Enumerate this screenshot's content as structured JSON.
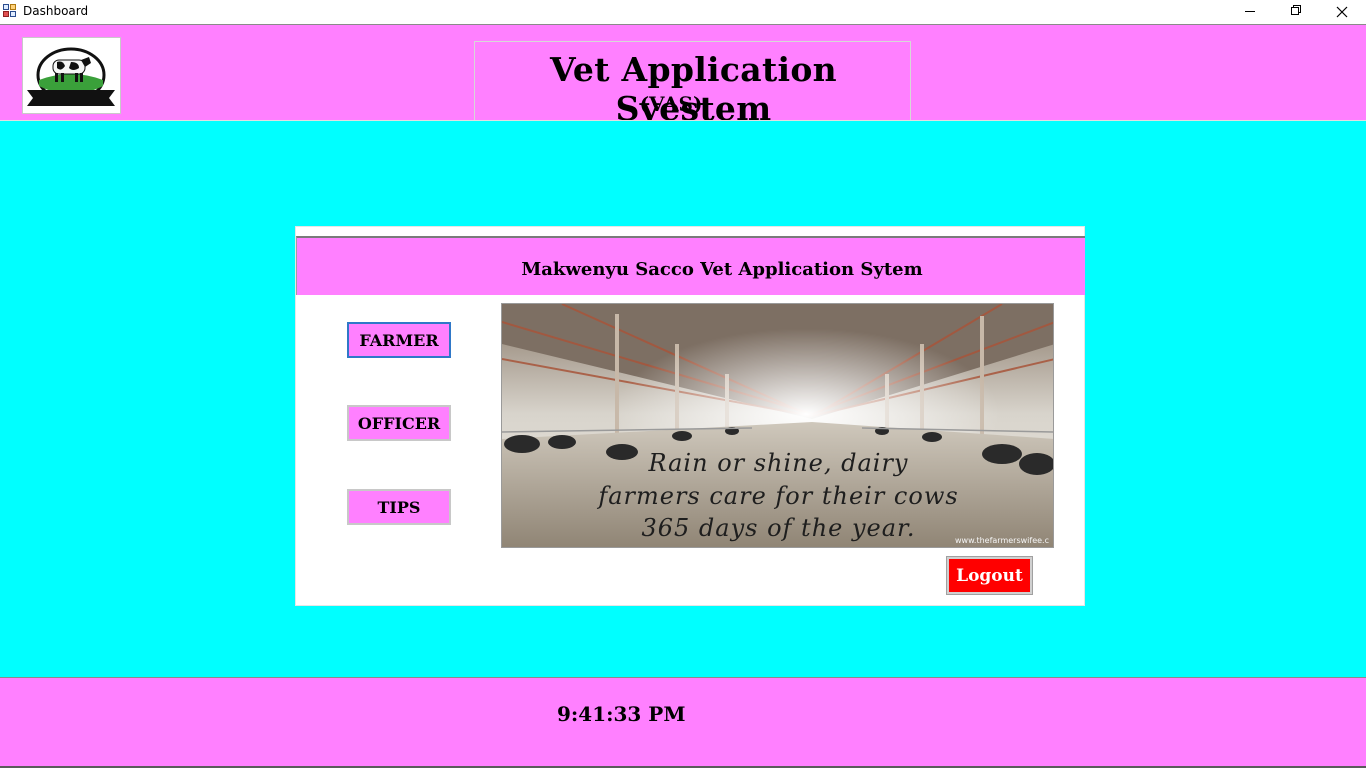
{
  "window": {
    "title": "Dashboard",
    "controls": [
      "minimize",
      "restore",
      "close"
    ]
  },
  "header": {
    "title": "Vet Application Syestem",
    "subtitle": "(VAS)",
    "logo_icon": "dairy-cow-logo-icon"
  },
  "card": {
    "title": "Makwenyu Sacco Vet Application Sytem",
    "nav": {
      "farmer_label": "FARMER",
      "officer_label": "OFFICER",
      "tips_label": "TIPS"
    },
    "photo": {
      "quote_line1": "Rain or shine, dairy",
      "quote_line2": "farmers care for their cows",
      "quote_line3": "365 days of the year.",
      "watermark": "www.thefarmerswifee.c"
    },
    "logout_label": "Logout"
  },
  "footer": {
    "clock": "9:41:33 PM"
  },
  "colors": {
    "header_bg": "#ff80ff",
    "main_bg": "#00ffff",
    "logout_bg": "#ff0000",
    "focus_border": "#2f78c8"
  }
}
